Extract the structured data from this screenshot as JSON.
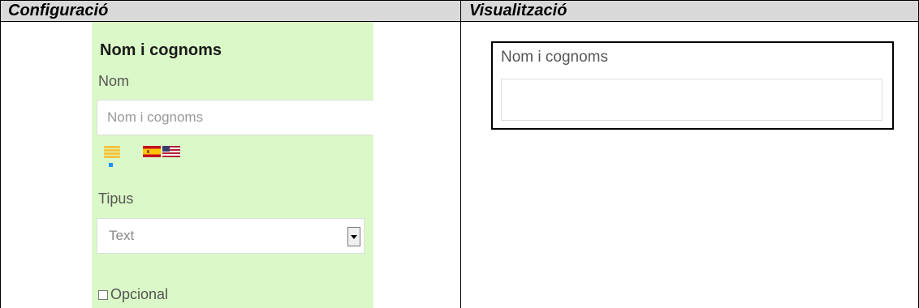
{
  "headers": {
    "config": "Configuració",
    "preview": "Visualització"
  },
  "config": {
    "field_title": "Nom i cognoms",
    "name_label": "Nom",
    "name_input_value": "Nom i cognoms",
    "type_label": "Tipus",
    "type_selected": "Text",
    "optional_label": "Opcional",
    "optional_checked": false,
    "language_icons": [
      "generic-language-icon",
      "spanish-flag-icon",
      "us-flag-icon"
    ]
  },
  "preview": {
    "label": "Nom i cognoms",
    "input_value": ""
  },
  "colors": {
    "panel_bg": "#dbf9c8",
    "header_bg": "#d9d9d9"
  }
}
